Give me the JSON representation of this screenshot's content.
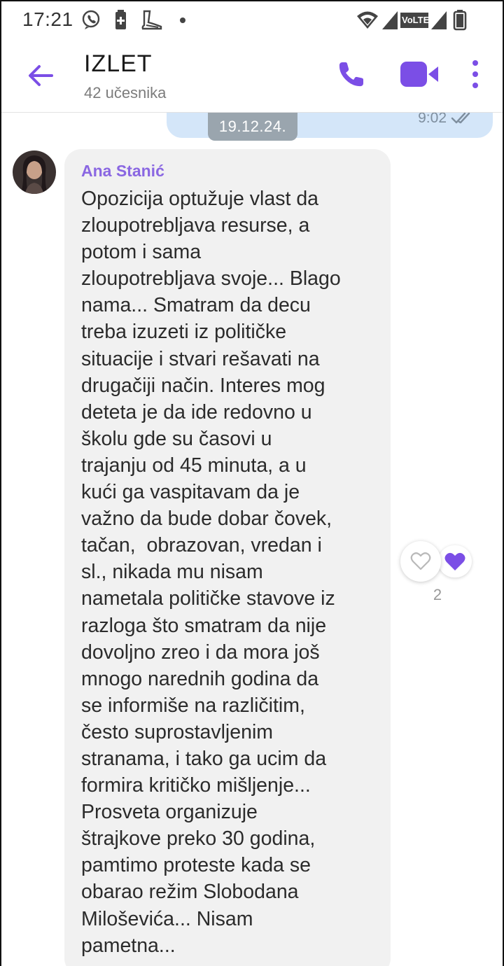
{
  "status_bar": {
    "time": "17:21",
    "icons": [
      "viber-icon",
      "battery-saver-icon",
      "app-icon",
      "dot-icon",
      "wifi-icon",
      "signal-icon",
      "volte-icon",
      "signal-icon",
      "battery-icon"
    ],
    "volte_label": "VoLTE"
  },
  "header": {
    "title": "IZLET",
    "subtitle": "42 učesnika",
    "accent_color": "#7b4ee6"
  },
  "chat": {
    "outgoing": {
      "time": "9:02",
      "status": "read"
    },
    "date_chip": "19.12.24.",
    "message": {
      "sender": "Ana Stanić",
      "lines": [
        "Opozicija optužuje vlast da",
        "zloupotrebljava resurse, a",
        "potom i sama",
        "zloupotrebljava svoje... Blago",
        "nama... Smatram da decu",
        "treba izuzeti iz političke",
        "situacije i stvari rešavati na",
        "drugačiji način. Interes mog",
        "deteta je da ide redovno u",
        "školu gde su časovi u",
        "trajanju od 45 minuta, a u",
        "kući ga vaspitavam da je",
        "važno da bude dobar čovek,",
        "tačan,  obrazovan, vredan i",
        "sl., nikada mu nisam",
        "nametala političke stavove iz",
        "razloga što smatram da nije",
        "dovoljno zreo i da mora još",
        "mnogo narednih godina da",
        "se informiše na različitim,",
        "često suprostavljenim",
        "stranama, i tako ga ucim da",
        "formira kritičko mišljenje...",
        "Prosveta organizuje",
        "štrajkove preko 30 godina,",
        "pamtimo proteste kada se",
        "obarao režim Slobodana",
        "Miloševića... Nisam",
        "pametna..."
      ],
      "reaction_count": "2"
    }
  }
}
